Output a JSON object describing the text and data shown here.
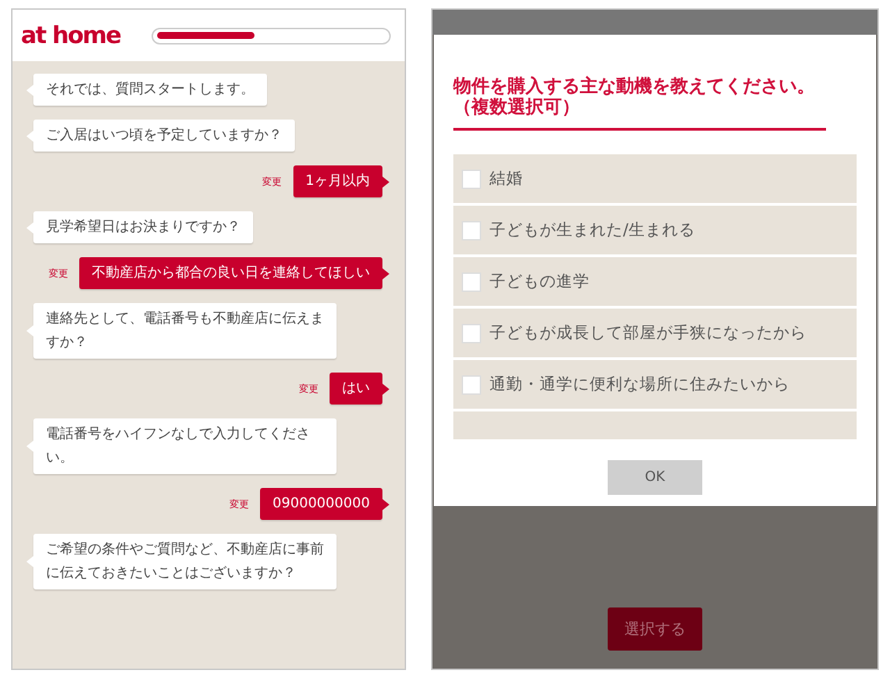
{
  "chat_screen": {
    "logo": "at home",
    "progress": {
      "level": 0.43
    },
    "messages": [
      {
        "kind": "bot",
        "text": "それでは、質問スタートします。"
      },
      {
        "kind": "bot",
        "text": "ご入居はいつ頃を予定していますか？"
      },
      {
        "kind": "user",
        "text": "1ヶ月以内",
        "edit_label": "変更"
      },
      {
        "kind": "bot",
        "text": "見学希望日はお決まりですか？"
      },
      {
        "kind": "user",
        "text": "不動産店から都合の良い日を連絡してほしい",
        "edit_label": "変更"
      },
      {
        "kind": "bot",
        "text": "連絡先として、電話番号も不動産店に伝えますか？"
      },
      {
        "kind": "user",
        "text": "はい",
        "edit_label": "変更"
      },
      {
        "kind": "bot",
        "text": "電話番号をハイフンなしで入力してください。"
      },
      {
        "kind": "user",
        "text": "09000000000",
        "edit_label": "変更"
      },
      {
        "kind": "bot",
        "text": "ご希望の条件やご質問など、不動産店に事前に伝えておきたいことはございますか？"
      }
    ]
  },
  "modal_screen": {
    "dialog": {
      "title": "物件を購入する主な動機を教えてください。（複数選択可）",
      "options": [
        {
          "label": "結婚",
          "checked": false
        },
        {
          "label": "子どもが生まれた/生まれる",
          "checked": false
        },
        {
          "label": "子どもの進学",
          "checked": false
        },
        {
          "label": "子どもが成長して部屋が手狭になったから",
          "checked": false
        },
        {
          "label": "通勤・通学に便利な場所に住みたいから",
          "checked": false
        }
      ],
      "ok_button": "OK"
    },
    "select_button": "選択する"
  }
}
